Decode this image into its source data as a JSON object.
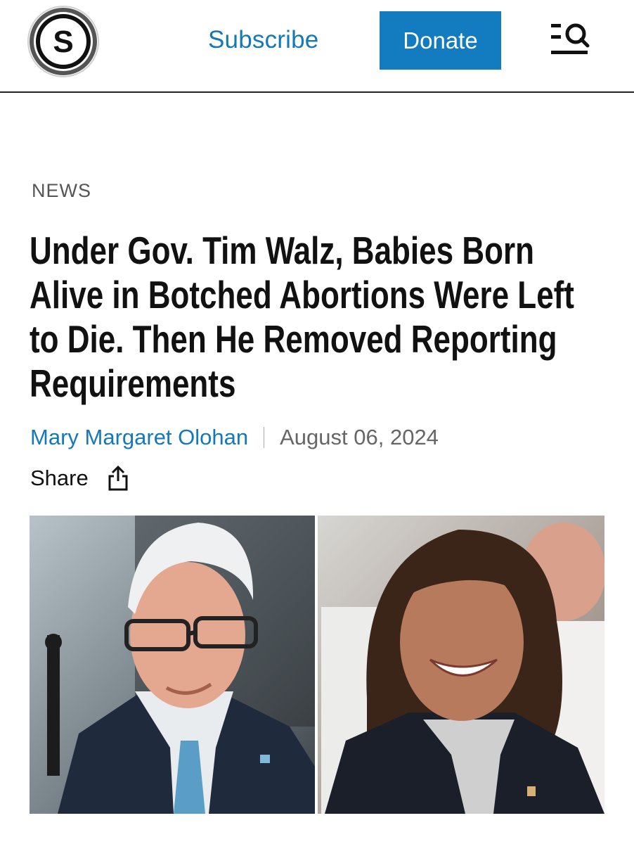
{
  "header": {
    "logo_letter": "S",
    "subscribe_label": "Subscribe",
    "donate_label": "Donate",
    "menu_search_icon": "menu-search-icon",
    "colors": {
      "link": "#1479b8",
      "donate_bg": "#137bc0",
      "divider": "#222222"
    }
  },
  "article": {
    "category": "NEWS",
    "headline": "Under Gov. Tim Walz, Babies Born Alive in Botched Abortions Were Left to Die. Then He Removed Reporting Requirements",
    "author": "Mary Margaret Olohan",
    "date": "August 06, 2024",
    "share_label": "Share",
    "share_icon": "share-icon"
  },
  "photo": {
    "description_icon": "photo"
  }
}
